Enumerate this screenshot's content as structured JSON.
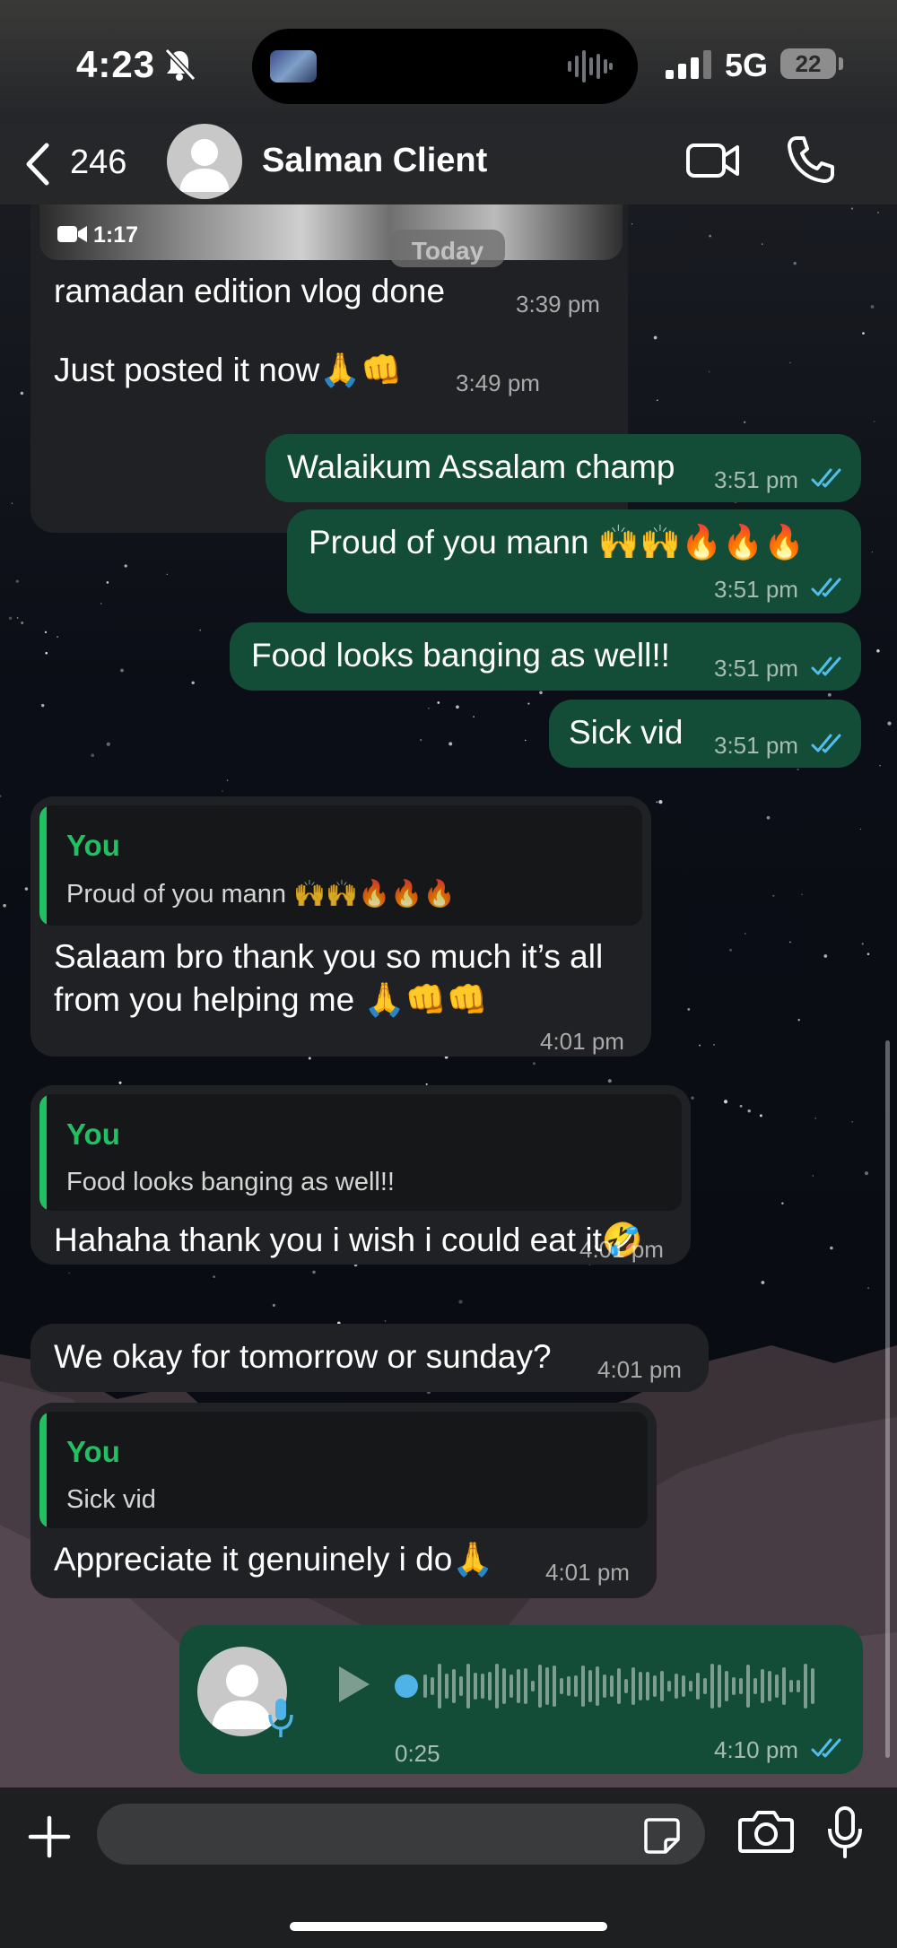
{
  "status_bar": {
    "time": "4:23",
    "network": "5G",
    "battery": "22"
  },
  "header": {
    "back_count": "246",
    "contact_name": "Salman Client"
  },
  "chat": {
    "video_duration": "1:17",
    "date_pill": "Today",
    "messages": [
      {
        "text": "ramadan edition vlog done",
        "time": "3:39 pm"
      },
      {
        "text": "Just posted it now🙏👊",
        "time": "3:49 pm"
      },
      {
        "text": "Walaikum Assalam champ",
        "time": "3:51 pm"
      },
      {
        "text": "Proud of you mann 🙌🙌🔥🔥🔥",
        "time": "3:51 pm"
      },
      {
        "text": "Food looks banging as well!!",
        "time": "3:51 pm"
      },
      {
        "text": "Sick vid",
        "time": "3:51 pm"
      },
      {
        "quote_author": "You",
        "quote_text": "Proud of you mann 🙌🙌🔥🔥🔥",
        "line1": "Salaam bro thank you so much it’s all",
        "line2": "from you helping me 🙏👊👊",
        "time": "4:01 pm"
      },
      {
        "quote_author": "You",
        "quote_text": "Food looks banging as well!!",
        "text": "Hahaha thank you i wish i could eat it🤣",
        "time": "4:01 pm"
      },
      {
        "text": "We okay for tomorrow or sunday?",
        "time": "4:01 pm"
      },
      {
        "quote_author": "You",
        "quote_text": "Sick vid",
        "text": "Appreciate it genuinely i do🙏",
        "time": "4:01 pm"
      }
    ],
    "voice_note": {
      "duration": "0:25",
      "time": "4:10 pm"
    }
  },
  "composer": {
    "placeholder": ""
  },
  "colors": {
    "incoming": "#202124",
    "outgoing": "#134d37",
    "accent": "#21c063",
    "read_ticks": "#53bdeb"
  },
  "icons": [
    "chevron-left-icon",
    "video-call-icon",
    "phone-icon",
    "plus-icon",
    "sticker-icon",
    "camera-icon",
    "mic-icon",
    "play-icon",
    "double-tick-icon"
  ]
}
